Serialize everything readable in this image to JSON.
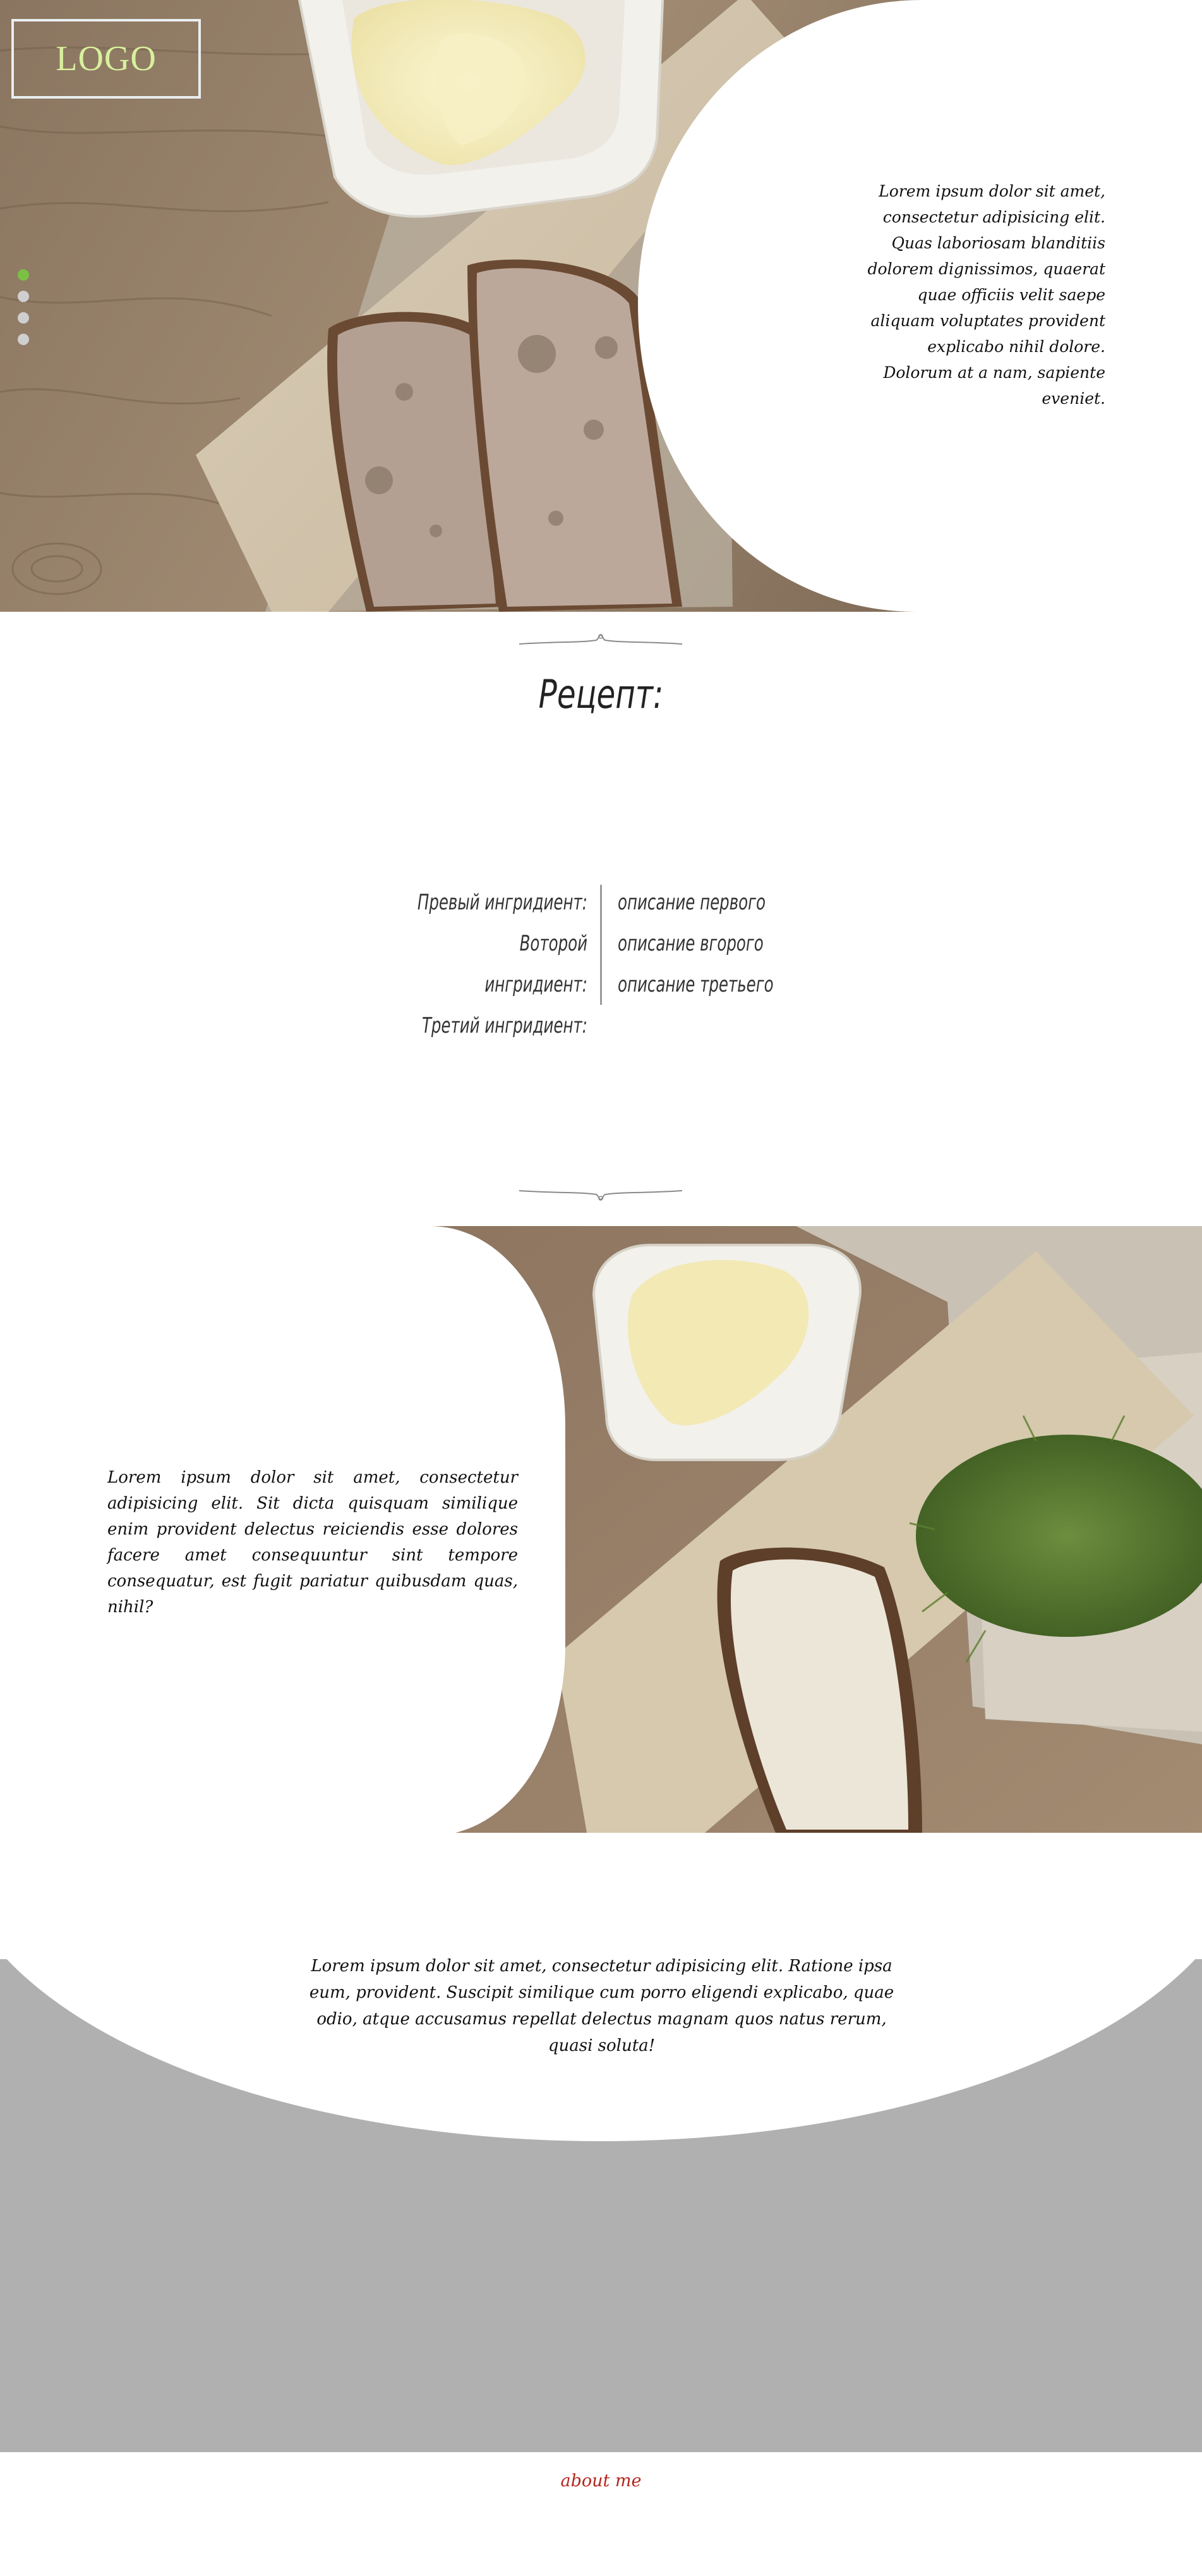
{
  "header": {
    "logo_text": "LOGO"
  },
  "slider": {
    "dots_count": 4,
    "active_index": 0
  },
  "hero": {
    "text": "Lorem ipsum dolor sit amet, consectetur adipisicing elit. Quas laboriosam blanditiis dolorem dignissimos, quaerat quae officiis velit saepe aliquam voluptates provident explicabo nihil dolore. Dolorum at a nam, sapiente eveniet."
  },
  "recipe": {
    "title": "Рецепт:",
    "rows": [
      {
        "ingredient": "Превый ингридиент:",
        "description": "описание первого"
      },
      {
        "ingredient": "Воторой ингридиент:",
        "description": "описание вгорого"
      },
      {
        "ingredient": "Третий ингридиент:",
        "description": "описание третьего"
      }
    ]
  },
  "feature": {
    "text": "Lorem ipsum dolor sit amet, consectetur adipisicing elit. Sit dicta quisquam similique enim provident delectus reiciendis esse dolores facere amet consequuntur sint tempore consequatur, est fugit pariatur quibusdam quas, nihil?"
  },
  "bottom": {
    "text": "Lorem ipsum dolor sit amet, consectetur adipisicing elit. Ratione ipsa eum, provident. Suscipit similique cum porro eligendi explicabo, quae odio, atque accusamus repellat delectus magnam quos natus rerum, quasi soluta!"
  },
  "footer": {
    "link_label": "about me"
  },
  "colors": {
    "logo": "#d7f09c",
    "active_dot": "#7cc043",
    "inactive_dot": "#cfcfcf",
    "grey_band": "#b0b0b0",
    "link": "#b3261e"
  }
}
